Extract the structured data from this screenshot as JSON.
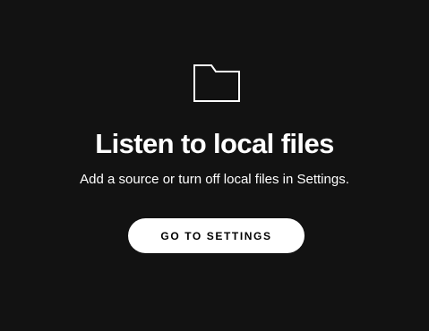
{
  "empty_state": {
    "icon": "folder-icon",
    "title": "Listen to local files",
    "subtitle": "Add a source or turn off local files in Settings.",
    "button_label": "GO TO SETTINGS"
  },
  "colors": {
    "background": "#121212",
    "text": "#ffffff",
    "button_background": "#ffffff",
    "button_text": "#000000"
  }
}
